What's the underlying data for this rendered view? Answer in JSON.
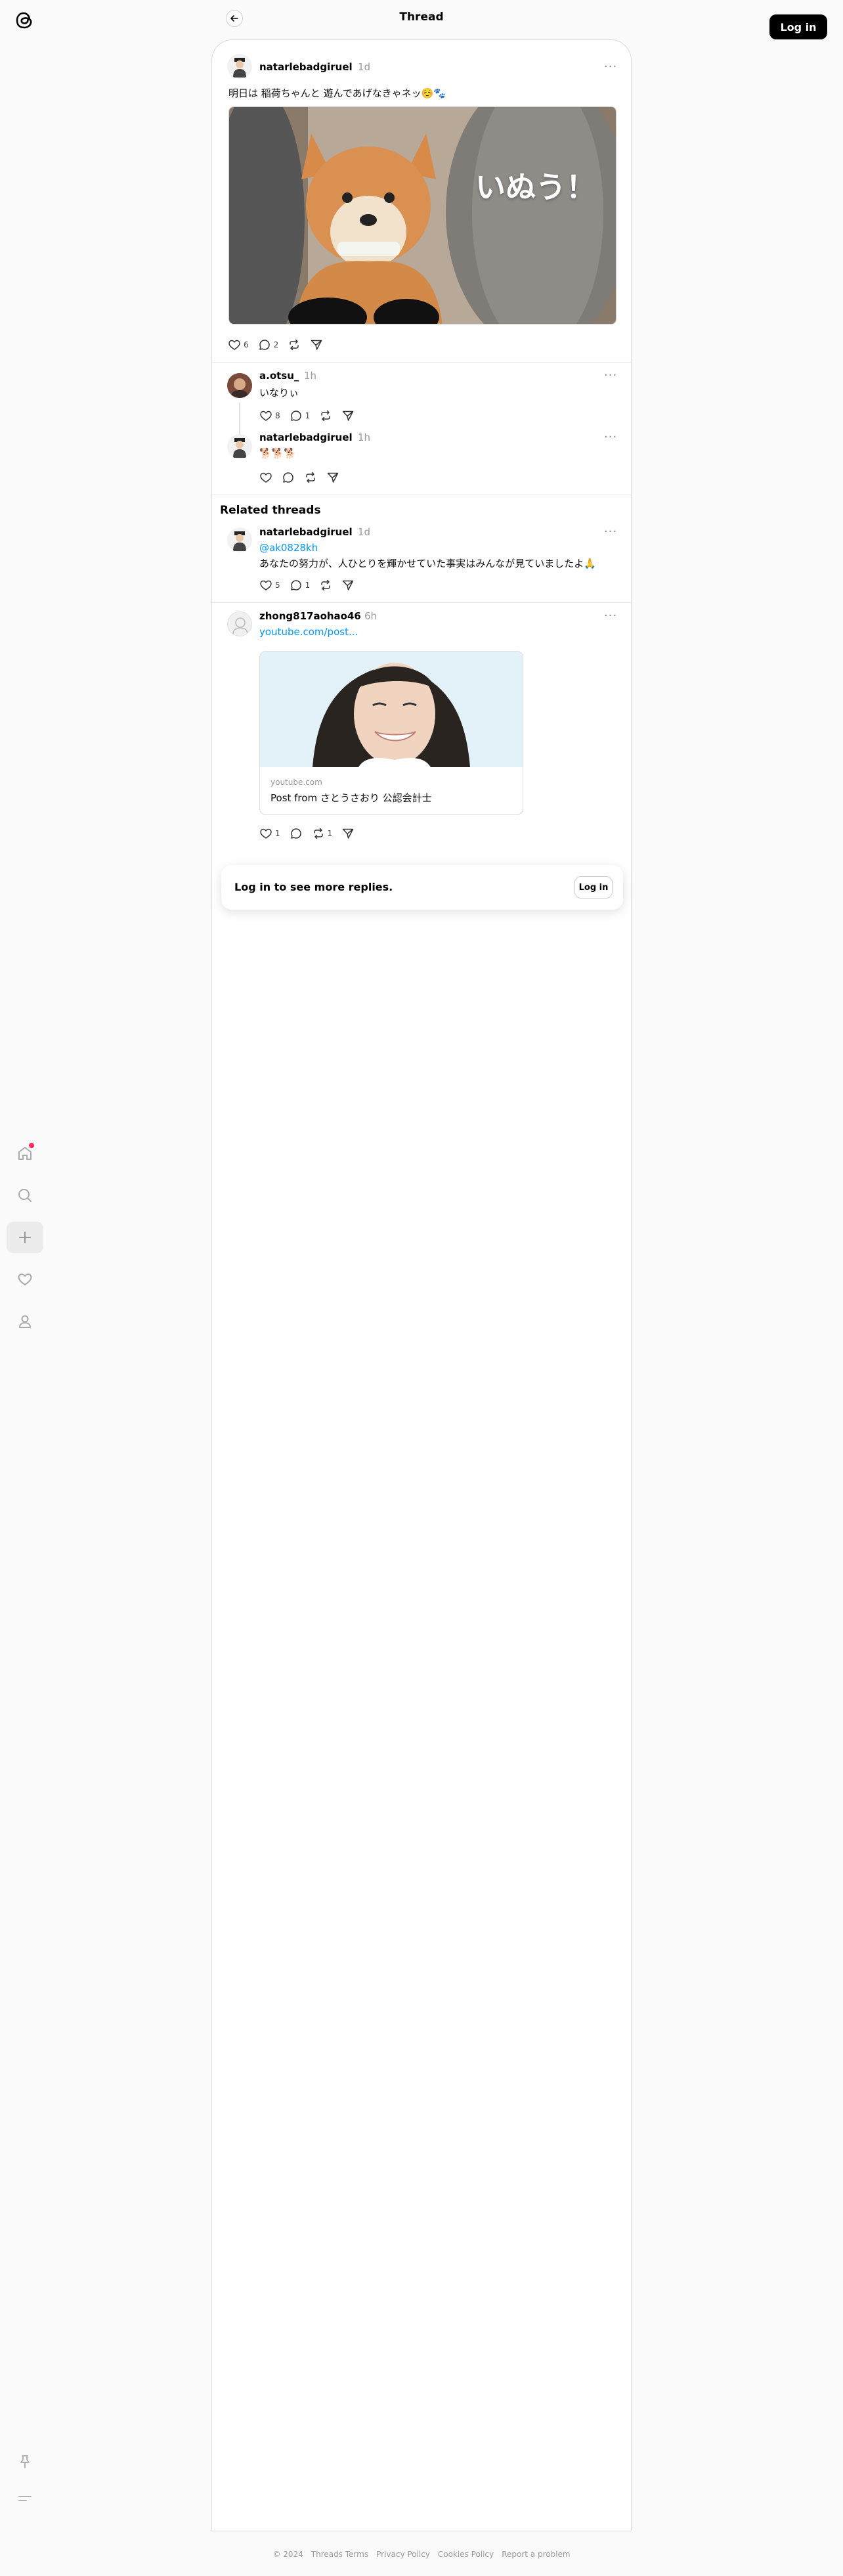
{
  "header": {
    "title": "Thread",
    "login_label": "Log in"
  },
  "main_post": {
    "username": "natarlebadgiruel",
    "time": "1d",
    "more": "···",
    "text": "明日は 稲荷ちゃんと 遊んであげなきゃネッ☺️🐾",
    "image_caption": "いぬう！",
    "likes": "6",
    "replies": "2"
  },
  "replies": [
    {
      "username": "a.otsu_",
      "time": "1h",
      "more": "···",
      "text": "いなりぃ",
      "likes": "8",
      "replies": "1"
    },
    {
      "username": "natarlebadgiruel",
      "time": "1h",
      "more": "···",
      "text": "🐕🐕🐕"
    }
  ],
  "related": {
    "title": "Related threads",
    "posts": [
      {
        "username": "natarlebadgiruel",
        "time": "1d",
        "more": "···",
        "mention": "@ak0828kh",
        "text": "あなたの努力が、人ひとりを輝かせていた事実はみんなが見ていましたよ🙏",
        "likes": "5",
        "replies": "1"
      },
      {
        "username": "zhong817aohao46",
        "time": "6h",
        "more": "···",
        "link": "youtube.com/post...",
        "card_domain": "youtube.com",
        "card_title": "Post from さとうさおり 公認会計士",
        "likes": "1",
        "reposts": "1"
      }
    ]
  },
  "login_prompt": {
    "text": "Log in to see more replies.",
    "button": "Log in"
  },
  "footer": {
    "copyright": "© 2024",
    "links": [
      "Threads Terms",
      "Privacy Policy",
      "Cookies Policy",
      "Report a problem"
    ]
  }
}
